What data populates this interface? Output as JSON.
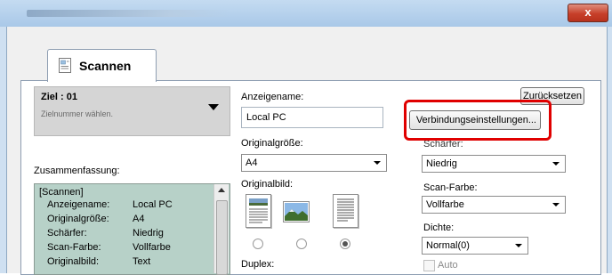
{
  "window": {
    "close_glyph": "x"
  },
  "tab": {
    "label": "Scannen",
    "icon": "document-scan-icon"
  },
  "destination": {
    "title": "Ziel : 01",
    "subtitle": "Zielnummer wählen."
  },
  "summary": {
    "label": "Zusammenfassung:",
    "header": "[Scannen]",
    "rows": [
      {
        "key": "Anzeigename:",
        "value": "Local PC"
      },
      {
        "key": "Originalgröße:",
        "value": "A4"
      },
      {
        "key": "Schärfer:",
        "value": "Niedrig"
      },
      {
        "key": "Scan-Farbe:",
        "value": "Vollfarbe"
      },
      {
        "key": "Originalbild:",
        "value": "Text"
      }
    ]
  },
  "form": {
    "display_name_label": "Anzeigename:",
    "display_name_value": "Local PC",
    "original_size_label": "Originalgröße:",
    "original_size_value": "A4",
    "original_image_label": "Originalbild:",
    "original_image_selected": 2,
    "duplex_label": "Duplex:",
    "sharpness_label": "Schärfer:",
    "sharpness_value": "Niedrig",
    "scan_color_label": "Scan-Farbe:",
    "scan_color_value": "Vollfarbe",
    "density_label": "Dichte:",
    "density_value": "Normal(0)",
    "auto_label": "Auto"
  },
  "buttons": {
    "reset": "Zurücksetzen",
    "connection_settings": "Verbindungseinstellungen..."
  },
  "colors": {
    "highlight": "#e00000",
    "summary_bg": "#b7d1c8"
  }
}
